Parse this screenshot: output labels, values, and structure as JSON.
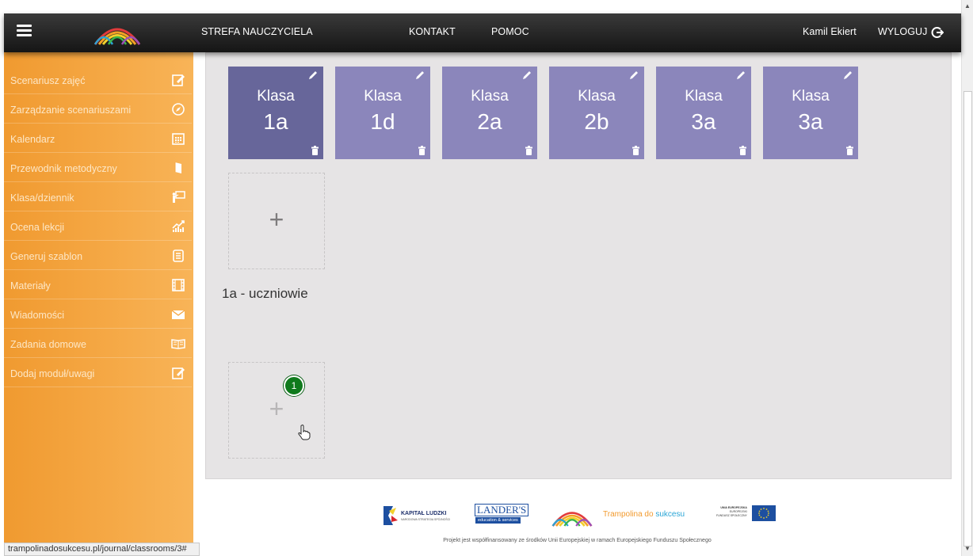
{
  "topbar": {
    "title": "STREFA NAUCZYCIELA",
    "contact": "KONTAKT",
    "help": "POMOC",
    "user": "Kamil Ekiert",
    "logout": "WYLOGUJ"
  },
  "sidebar": {
    "items": [
      {
        "label": "Scenariusz zajęć",
        "icon": "edit-icon"
      },
      {
        "label": "Zarządzanie scenariuszami",
        "icon": "compass-icon"
      },
      {
        "label": "Kalendarz",
        "icon": "calendar-icon"
      },
      {
        "label": "Przewodnik metodyczny",
        "icon": "book-icon"
      },
      {
        "label": "Klasa/dziennik",
        "icon": "teacher-board-icon"
      },
      {
        "label": "Ocena lekcji",
        "icon": "chart-icon"
      },
      {
        "label": "Generuj szablon",
        "icon": "document-icon"
      },
      {
        "label": "Materiały",
        "icon": "film-icon"
      },
      {
        "label": "Wiadomości",
        "icon": "envelope-icon"
      },
      {
        "label": "Zadania domowe",
        "icon": "open-book-icon"
      },
      {
        "label": "Dodaj moduł/uwagi",
        "icon": "note-icon"
      }
    ]
  },
  "classes": [
    {
      "name": "Klasa",
      "code": "1a",
      "color": "#67669a"
    },
    {
      "name": "Klasa",
      "code": "1d",
      "color": "#8b86bb"
    },
    {
      "name": "Klasa",
      "code": "2a",
      "color": "#8b86bb"
    },
    {
      "name": "Klasa",
      "code": "2b",
      "color": "#8b86bb"
    },
    {
      "name": "Klasa",
      "code": "3a",
      "color": "#8b86bb"
    },
    {
      "name": "Klasa",
      "code": "3a",
      "color": "#8b86bb"
    }
  ],
  "add_symbol": "+",
  "section_title": "1a - uczniowie",
  "badge_count": "1",
  "footer": {
    "funding_text": "Projekt jest współfinansowany ze środków Unii Europejskiej w ramach Europejskiego Funduszu Społecznego",
    "kapital": "KAPITAŁ LUDZKI",
    "kapital_sub": "NARODOWA STRATEGIA SPÓJNOŚCI",
    "landers": "LANDER'S",
    "landers_sub": "education & services",
    "trampolina_a": "Trampolina do",
    "trampolina_b": "sukcesu",
    "ue_line1": "UNIA EUROPEJSKA",
    "ue_line2": "EUROPEJSKI",
    "ue_line3": "FUNDUSZ SPOŁECZNY"
  },
  "status_url": "trampolinadosukcesu.pl/journal/classrooms/3#",
  "colors": {
    "accent_orange": "#f5a845",
    "tile_active": "#67669a",
    "tile": "#8b86bb",
    "trampolina_orange": "#f29a2e",
    "trampolina_blue": "#2aa5d6"
  }
}
